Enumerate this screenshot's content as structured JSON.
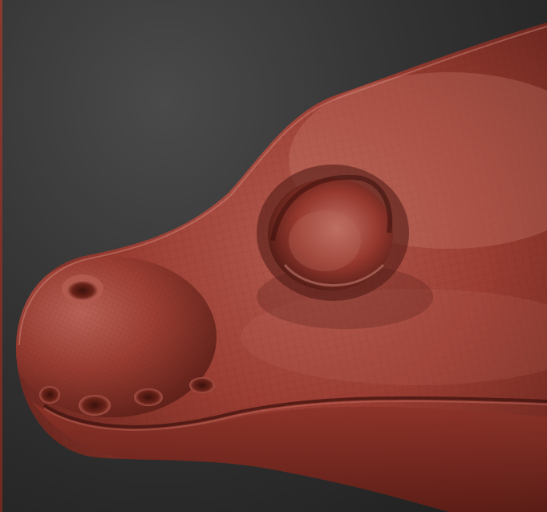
{
  "scene": {
    "subject": "sculpted-reptile-head",
    "background_color": "#2b2b2b",
    "clay_base_color": "#9b3d32",
    "clay_highlight_color": "#c8736a",
    "clay_shadow_color": "#4a1712",
    "wireframe_visible": true
  }
}
